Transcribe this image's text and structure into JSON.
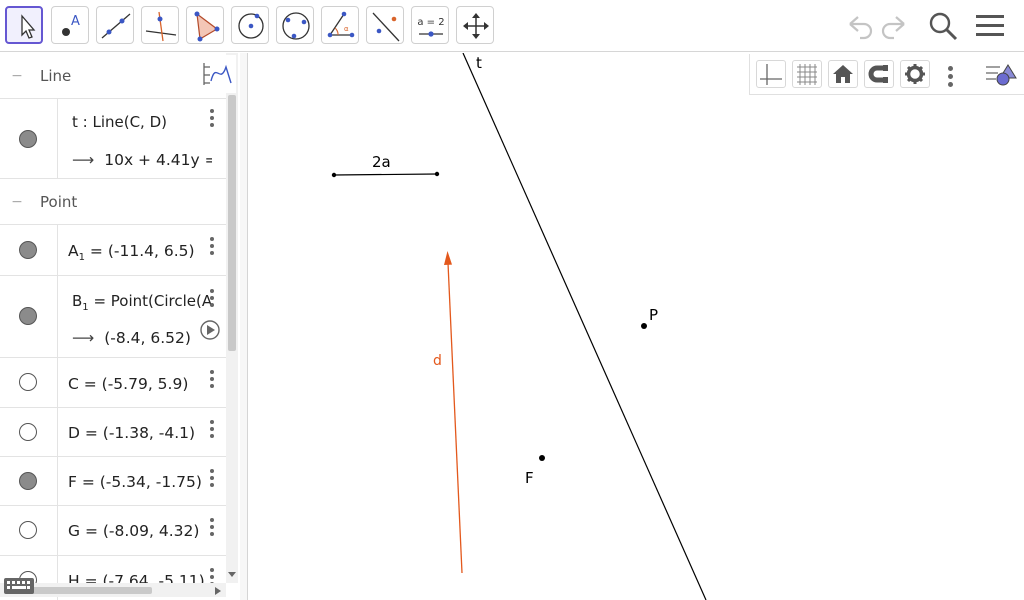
{
  "toolbar": {
    "tools": [
      {
        "name": "move-tool",
        "active": true
      },
      {
        "name": "point-tool",
        "glyph": "A"
      },
      {
        "name": "line-tool"
      },
      {
        "name": "perpendicular-line-tool"
      },
      {
        "name": "polygon-tool"
      },
      {
        "name": "circle-center-point-tool"
      },
      {
        "name": "circle-three-points-tool"
      },
      {
        "name": "angle-tool"
      },
      {
        "name": "reflect-tool"
      },
      {
        "name": "slider-tool",
        "label": "a = 2"
      },
      {
        "name": "move-graphics-view-tool"
      }
    ],
    "right_icons": [
      "undo-icon",
      "redo-icon",
      "search-icon",
      "menu-icon"
    ]
  },
  "algebra": {
    "groups": [
      {
        "label": "Line",
        "toggle": "−"
      },
      {
        "label": "Point",
        "toggle": "−"
      }
    ],
    "line_t": {
      "definition": "t : Line(C, D)",
      "value": "10x + 4.41y = -"
    },
    "points": {
      "A1": {
        "name": "A",
        "sub": "1",
        "value": "= (-11.4, 6.5)"
      },
      "B1": {
        "name": "B",
        "sub": "1",
        "definition": "= Point(Circle(",
        "definition_tail": "A",
        "definition_tail_sub": "1",
        "value": "(-8.4, 6.52)"
      },
      "C": {
        "text": "C = (-5.79, 5.9)"
      },
      "D": {
        "text": "D = (-1.38, -4.1)"
      },
      "F": {
        "text": "F = (-5.34, -1.75)"
      },
      "G": {
        "text": "G = (-8.09, 4.32)"
      },
      "H": {
        "text": "H = (-7.64, -5.11)"
      }
    },
    "arrow": "⟶"
  },
  "graphics": {
    "labels": {
      "line_t": "t",
      "segment": "2a",
      "vector_d": "d",
      "point_P": "P",
      "point_F": "F"
    },
    "colors": {
      "vector": "#e3581c",
      "line": "#000000",
      "accent": "#6557d2"
    },
    "style_bar_icons": [
      "axes-icon",
      "grid-icon",
      "home-icon",
      "magnet-icon",
      "gear-icon",
      "more-icon",
      "style-bar-toggle-icon"
    ]
  }
}
